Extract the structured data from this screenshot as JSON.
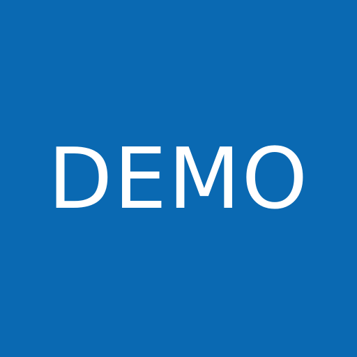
{
  "background_color": "#0a69b2",
  "text_color": "#ffffff",
  "label": "DEMO"
}
